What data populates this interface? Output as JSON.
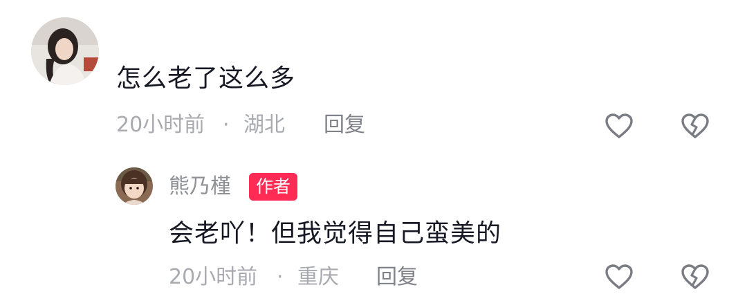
{
  "comments": [
    {
      "username": "",
      "content": "怎么老了这么多",
      "time": "20小时前",
      "separator": "·",
      "location": "湖北",
      "reply_label": "回复",
      "like_icon": "heart-outline-icon",
      "dislike_icon": "broken-heart-icon"
    },
    {
      "username": "熊乃槿",
      "badge": "作者",
      "content": "会老吖！但我觉得自己蛮美的",
      "time": "20小时前",
      "separator": "·",
      "location": "重庆",
      "reply_label": "回复",
      "like_icon": "heart-outline-icon",
      "dislike_icon": "broken-heart-icon"
    }
  ],
  "colors": {
    "text_primary": "#161823",
    "text_secondary": "#8f9096",
    "badge_bg": "#fe2c55",
    "icon": "#7a7c84"
  }
}
